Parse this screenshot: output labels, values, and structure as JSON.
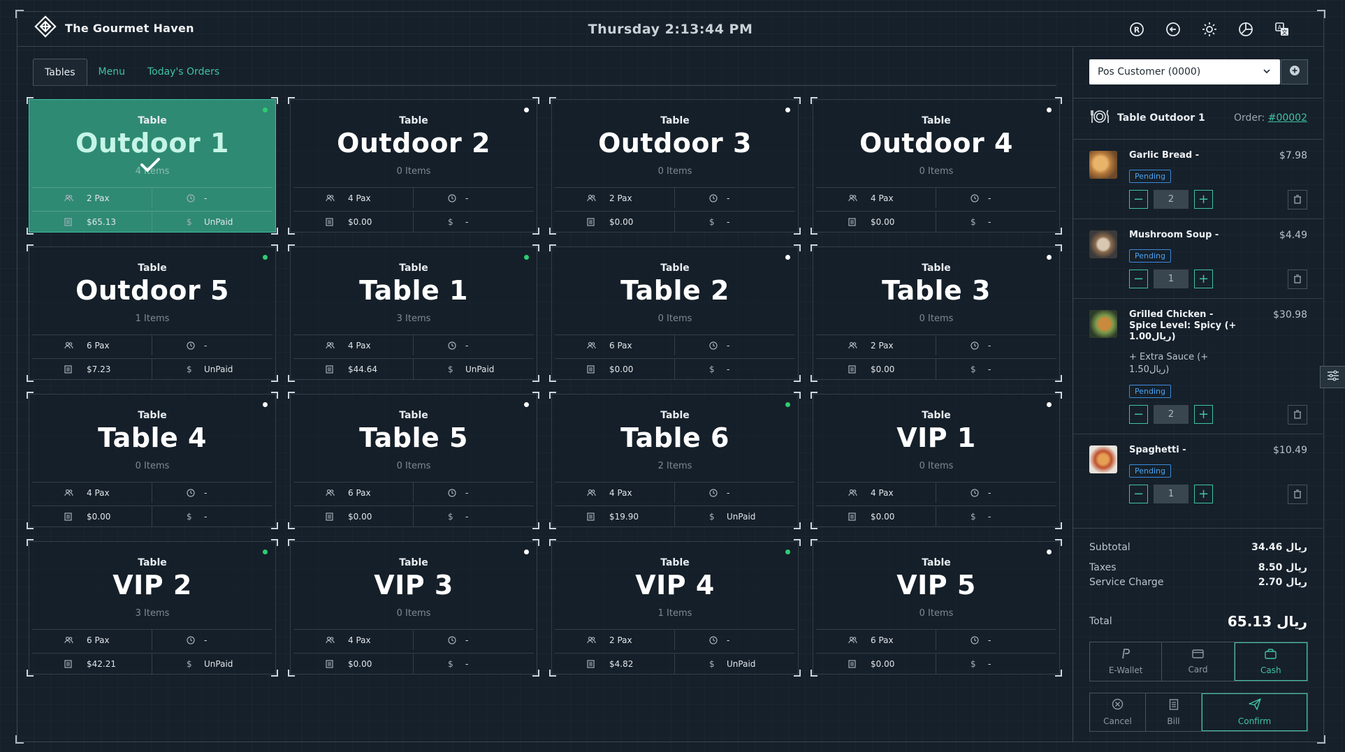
{
  "app": {
    "name": "The Gourmet Haven",
    "clock": "Thursday 2:13:44 PM"
  },
  "header_icons": [
    "registered-icon",
    "back-arrow-icon",
    "sun-icon",
    "pie-chart-icon",
    "translate-icon"
  ],
  "tabs": [
    {
      "label": "Tables",
      "active": true
    },
    {
      "label": "Menu",
      "active": false
    },
    {
      "label": "Today's Orders",
      "active": false
    }
  ],
  "tables": [
    {
      "label": "Table",
      "name": "Outdoor 1",
      "items": "4 Items",
      "pax": "2 Pax",
      "time": "-",
      "amount": "$65.13",
      "status": "UnPaid",
      "dot": "green",
      "selected": true
    },
    {
      "label": "Table",
      "name": "Outdoor 2",
      "items": "0 Items",
      "pax": "4 Pax",
      "time": "-",
      "amount": "$0.00",
      "status": "-",
      "dot": "white",
      "selected": false
    },
    {
      "label": "Table",
      "name": "Outdoor 3",
      "items": "0 Items",
      "pax": "2 Pax",
      "time": "-",
      "amount": "$0.00",
      "status": "-",
      "dot": "white",
      "selected": false
    },
    {
      "label": "Table",
      "name": "Outdoor 4",
      "items": "0 Items",
      "pax": "4 Pax",
      "time": "-",
      "amount": "$0.00",
      "status": "-",
      "dot": "white",
      "selected": false
    },
    {
      "label": "Table",
      "name": "Outdoor 5",
      "items": "1 Items",
      "pax": "6 Pax",
      "time": "-",
      "amount": "$7.23",
      "status": "UnPaid",
      "dot": "green",
      "selected": false
    },
    {
      "label": "Table",
      "name": "Table 1",
      "items": "3 Items",
      "pax": "4 Pax",
      "time": "-",
      "amount": "$44.64",
      "status": "UnPaid",
      "dot": "green",
      "selected": false
    },
    {
      "label": "Table",
      "name": "Table 2",
      "items": "0 Items",
      "pax": "6 Pax",
      "time": "-",
      "amount": "$0.00",
      "status": "-",
      "dot": "white",
      "selected": false
    },
    {
      "label": "Table",
      "name": "Table 3",
      "items": "0 Items",
      "pax": "2 Pax",
      "time": "-",
      "amount": "$0.00",
      "status": "-",
      "dot": "white",
      "selected": false
    },
    {
      "label": "Table",
      "name": "Table 4",
      "items": "0 Items",
      "pax": "4 Pax",
      "time": "-",
      "amount": "$0.00",
      "status": "-",
      "dot": "white",
      "selected": false
    },
    {
      "label": "Table",
      "name": "Table 5",
      "items": "0 Items",
      "pax": "6 Pax",
      "time": "-",
      "amount": "$0.00",
      "status": "-",
      "dot": "white",
      "selected": false
    },
    {
      "label": "Table",
      "name": "Table 6",
      "items": "2 Items",
      "pax": "4 Pax",
      "time": "-",
      "amount": "$19.90",
      "status": "UnPaid",
      "dot": "green",
      "selected": false
    },
    {
      "label": "Table",
      "name": "VIP 1",
      "items": "0 Items",
      "pax": "4 Pax",
      "time": "-",
      "amount": "$0.00",
      "status": "-",
      "dot": "white",
      "selected": false
    },
    {
      "label": "Table",
      "name": "VIP 2",
      "items": "3 Items",
      "pax": "6 Pax",
      "time": "-",
      "amount": "$42.21",
      "status": "UnPaid",
      "dot": "green",
      "selected": false
    },
    {
      "label": "Table",
      "name": "VIP 3",
      "items": "0 Items",
      "pax": "4 Pax",
      "time": "-",
      "amount": "$0.00",
      "status": "-",
      "dot": "white",
      "selected": false
    },
    {
      "label": "Table",
      "name": "VIP 4",
      "items": "1 Items",
      "pax": "2 Pax",
      "time": "-",
      "amount": "$4.82",
      "status": "UnPaid",
      "dot": "green",
      "selected": false
    },
    {
      "label": "Table",
      "name": "VIP 5",
      "items": "0 Items",
      "pax": "6 Pax",
      "time": "-",
      "amount": "$0.00",
      "status": "-",
      "dot": "white",
      "selected": false
    }
  ],
  "order": {
    "customer": "Pos Customer (0000)",
    "table_name": "Table Outdoor 1",
    "order_label": "Order:",
    "order_number": "#00002",
    "items": [
      {
        "name": "Garlic Bread -",
        "price": "$7.98",
        "extra": "",
        "status": "Pending",
        "qty": "2"
      },
      {
        "name": "Mushroom Soup -",
        "price": "$4.49",
        "extra": "",
        "status": "Pending",
        "qty": "1"
      },
      {
        "name": "Grilled Chicken - Spice Level: Spicy (+ 1.00ريال)",
        "price": "$30.98",
        "extra": "+ Extra Sauce (+ 1.50ريال)",
        "status": "Pending",
        "qty": "2"
      },
      {
        "name": "Spaghetti -",
        "price": "$10.49",
        "extra": "",
        "status": "Pending",
        "qty": "1"
      }
    ],
    "subtotal_label": "Subtotal",
    "subtotal": "34.46 ريال",
    "taxes_label": "Taxes",
    "taxes": "8.50 ريال",
    "service_label": "Service Charge",
    "service": "2.70 ريال",
    "total_label": "Total",
    "total": "65.13 ريال",
    "payment_methods": [
      {
        "label": "E-Wallet",
        "active": false
      },
      {
        "label": "Card",
        "active": false
      },
      {
        "label": "Cash",
        "active": true
      }
    ],
    "actions": {
      "cancel": "Cancel",
      "bill": "Bill",
      "confirm": "Confirm"
    }
  },
  "colors": {
    "accent": "#3fc3a4",
    "selected_card": "#2f8a73",
    "pending": "#4aa3f0",
    "status_dot_green": "#2ecc71"
  }
}
